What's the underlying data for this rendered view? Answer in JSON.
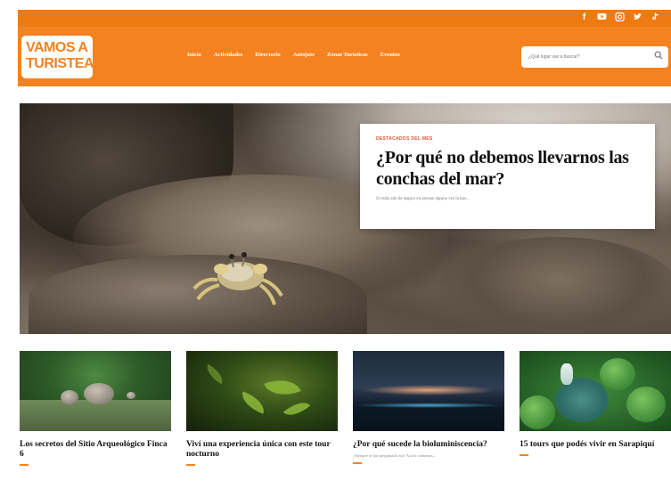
{
  "header": {
    "logo_line1": "VAMOS A",
    "logo_line2": "TURISTEAR",
    "nav": [
      "Inicio",
      "Actividades",
      "Directorio",
      "Antojate",
      "Zonas Turísticas",
      "Eventos"
    ],
    "search_placeholder": "¿Qué lugar vas a buscar?",
    "social_icons": [
      "facebook-icon",
      "youtube-icon",
      "instagram-icon",
      "twitter-icon",
      "tiktok-icon"
    ]
  },
  "colors": {
    "brand": "#f58220",
    "kicker": "#e2572b"
  },
  "hero": {
    "kicker": "DESTACADOS DEL MES",
    "title": "¿Por qué no debemos llevarnos las conchas del mar?",
    "excerpt": "Si estás aún de seguro en porque alguna vez la has..."
  },
  "cards": [
    {
      "title": "Los secretos del Sitio Arqueológico Finca 6",
      "excerpt": ""
    },
    {
      "title": "Viví una experiencia única con este tour nocturno",
      "excerpt": ""
    },
    {
      "title": "¿Por qué sucede la bioluminiscencia?",
      "excerpt": "¿Siempre te has preguntado eso? Acá te contamos..."
    },
    {
      "title": "15 tours que podés vivir en Sarapiquí",
      "excerpt": ""
    }
  ]
}
